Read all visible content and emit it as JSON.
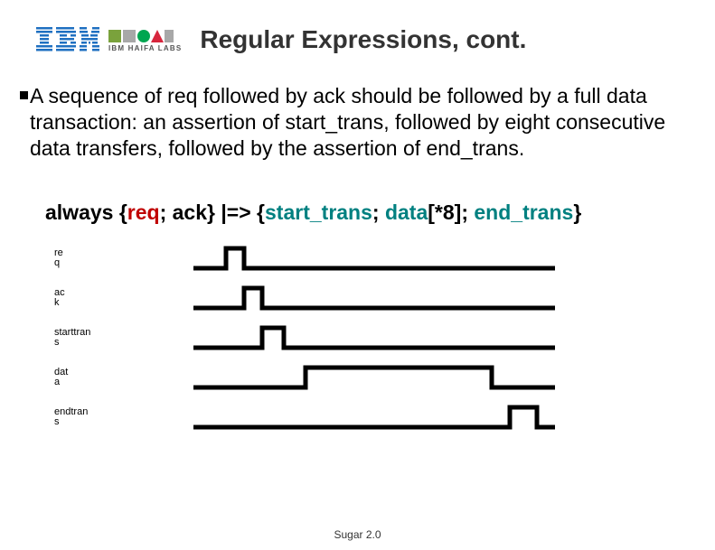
{
  "header": {
    "brand": "IBM",
    "lab": "IBM HAIFA LABS",
    "title": "Regular Expressions, cont."
  },
  "body": {
    "paragraph": "A sequence of req followed by ack should be followed by a full data transaction:  an assertion of start_trans, followed by eight consecutive data transfers, followed by the assertion of end_trans."
  },
  "assertion": {
    "p1": "always {",
    "p2": "req",
    "p3": "; ack",
    "p4": "} |=> {",
    "p5": "start_trans",
    "p6": "; ",
    "p7": "data",
    "p8": "[*8]; ",
    "p9": "end_trans",
    "p10": "}"
  },
  "waves": {
    "labels": {
      "req": "re\nq",
      "ack": "ac\nk",
      "starttrans": "starttran\ns",
      "data": "dat\na",
      "endtrans": "endtran\ns"
    }
  },
  "footer": "Sugar 2.0"
}
